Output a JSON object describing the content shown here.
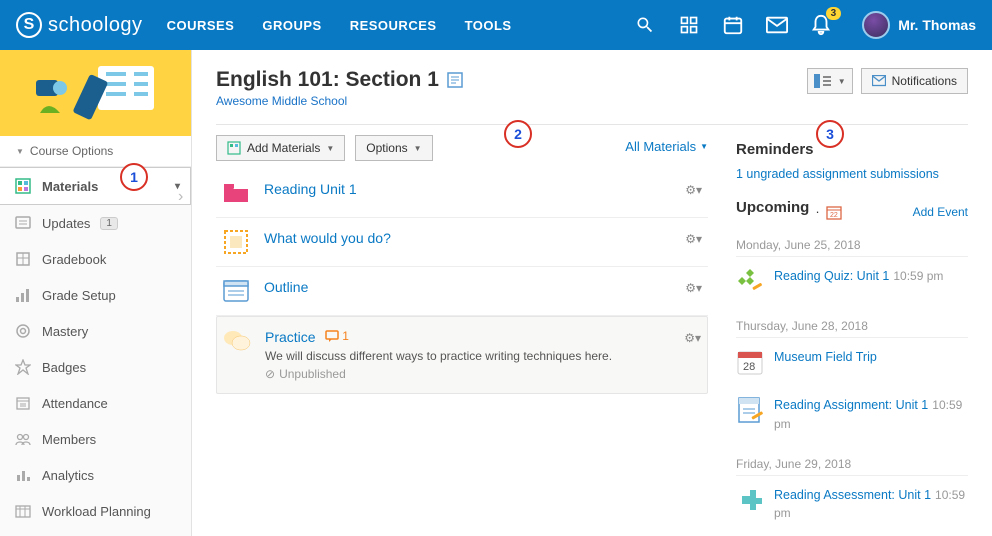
{
  "header": {
    "brand": "schoology",
    "nav": [
      "COURSES",
      "GROUPS",
      "RESOURCES",
      "TOOLS"
    ],
    "notification_count": "3",
    "user_name": "Mr. Thomas"
  },
  "sidebar": {
    "course_options": "Course Options",
    "items": [
      {
        "label": "Materials",
        "badge": null,
        "active": true
      },
      {
        "label": "Updates",
        "badge": "1"
      },
      {
        "label": "Gradebook"
      },
      {
        "label": "Grade Setup"
      },
      {
        "label": "Mastery"
      },
      {
        "label": "Badges"
      },
      {
        "label": "Attendance"
      },
      {
        "label": "Members"
      },
      {
        "label": "Analytics"
      },
      {
        "label": "Workload Planning"
      }
    ]
  },
  "course": {
    "title": "English 101: Section 1",
    "school": "Awesome Middle School",
    "notifications_btn": "Notifications"
  },
  "toolbar": {
    "add_materials": "Add Materials",
    "options": "Options",
    "all_materials": "All Materials"
  },
  "materials": [
    {
      "type": "folder",
      "title": "Reading Unit 1"
    },
    {
      "type": "assignment",
      "title": "What would you do?"
    },
    {
      "type": "page",
      "title": "Outline"
    },
    {
      "type": "discussion",
      "title": "Practice",
      "count": "1",
      "desc": "We will discuss different ways to practice writing techniques here.",
      "unpub": "Unpublished"
    }
  ],
  "reminders": {
    "heading": "Reminders",
    "link": "1 ungraded assignment submissions"
  },
  "upcoming": {
    "heading": "Upcoming",
    "add_event": "Add Event",
    "days": [
      {
        "label": "Monday, June 25, 2018",
        "events": [
          {
            "title": "Reading Quiz: Unit 1",
            "time": "10:59 pm",
            "icon": "quiz"
          }
        ]
      },
      {
        "label": "Thursday, June 28, 2018",
        "events": [
          {
            "title": "Museum Field Trip",
            "time": "",
            "icon": "cal",
            "day": "28"
          },
          {
            "title": "Reading Assignment: Unit 1",
            "time": "10:59 pm",
            "icon": "assign"
          }
        ]
      },
      {
        "label": "Friday, June 29, 2018",
        "events": [
          {
            "title": "Reading Assessment: Unit 1",
            "time": "10:59 pm",
            "icon": "assess"
          }
        ]
      }
    ]
  },
  "annotations": [
    "1",
    "2",
    "3"
  ]
}
